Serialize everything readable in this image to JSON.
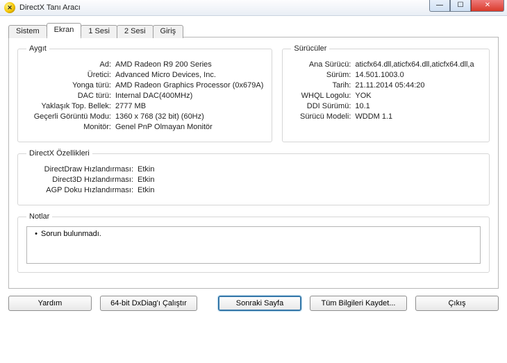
{
  "title": "DirectX Tanı Aracı",
  "tabs": {
    "sistem": "Sistem",
    "ekran": "Ekran",
    "ses1": "1 Sesi",
    "ses2": "2 Sesi",
    "giris": "Giriş"
  },
  "device": {
    "legend": "Aygıt",
    "rows": {
      "ad": {
        "label": "Ad:",
        "value": "AMD Radeon R9 200 Series"
      },
      "uretici": {
        "label": "Üretici:",
        "value": "Advanced Micro Devices, Inc."
      },
      "yonga": {
        "label": "Yonga türü:",
        "value": "AMD Radeon Graphics Processor (0x679A)"
      },
      "dac": {
        "label": "DAC türü:",
        "value": "Internal DAC(400MHz)"
      },
      "bellek": {
        "label": "Yaklaşık Top. Bellek:",
        "value": "2777 MB"
      },
      "mod": {
        "label": "Geçerli Görüntü Modu:",
        "value": "1360 x 768 (32 bit) (60Hz)"
      },
      "monitor": {
        "label": "Monitör:",
        "value": "Genel PnP Olmayan Monitör"
      }
    }
  },
  "drivers": {
    "legend": "Sürücüler",
    "rows": {
      "ana": {
        "label": "Ana Sürücü:",
        "value": "aticfx64.dll,aticfx64.dll,aticfx64.dll,a"
      },
      "surum": {
        "label": "Sürüm:",
        "value": "14.501.1003.0"
      },
      "tarih": {
        "label": "Tarih:",
        "value": "21.11.2014 05:44:20"
      },
      "whql": {
        "label": "WHQL Logolu:",
        "value": "YOK"
      },
      "ddi": {
        "label": "DDI Sürümü:",
        "value": "10.1"
      },
      "model": {
        "label": "Sürücü Modeli:",
        "value": "WDDM 1.1"
      }
    }
  },
  "features": {
    "legend": "DirectX Özellikleri",
    "rows": {
      "ddraw": {
        "label": "DirectDraw Hızlandırması:",
        "value": "Etkin"
      },
      "d3d": {
        "label": "Direct3D Hızlandırması:",
        "value": "Etkin"
      },
      "agp": {
        "label": "AGP Doku Hızlandırması:",
        "value": "Etkin"
      }
    }
  },
  "notes": {
    "legend": "Notlar",
    "lines": [
      "Sorun bulunmadı."
    ]
  },
  "buttons": {
    "help": "Yardım",
    "dxdiag64": "64-bit DxDiag'ı Çalıştır",
    "next": "Sonraki Sayfa",
    "saveAll": "Tüm Bilgileri Kaydet...",
    "exit": "Çıkış"
  }
}
